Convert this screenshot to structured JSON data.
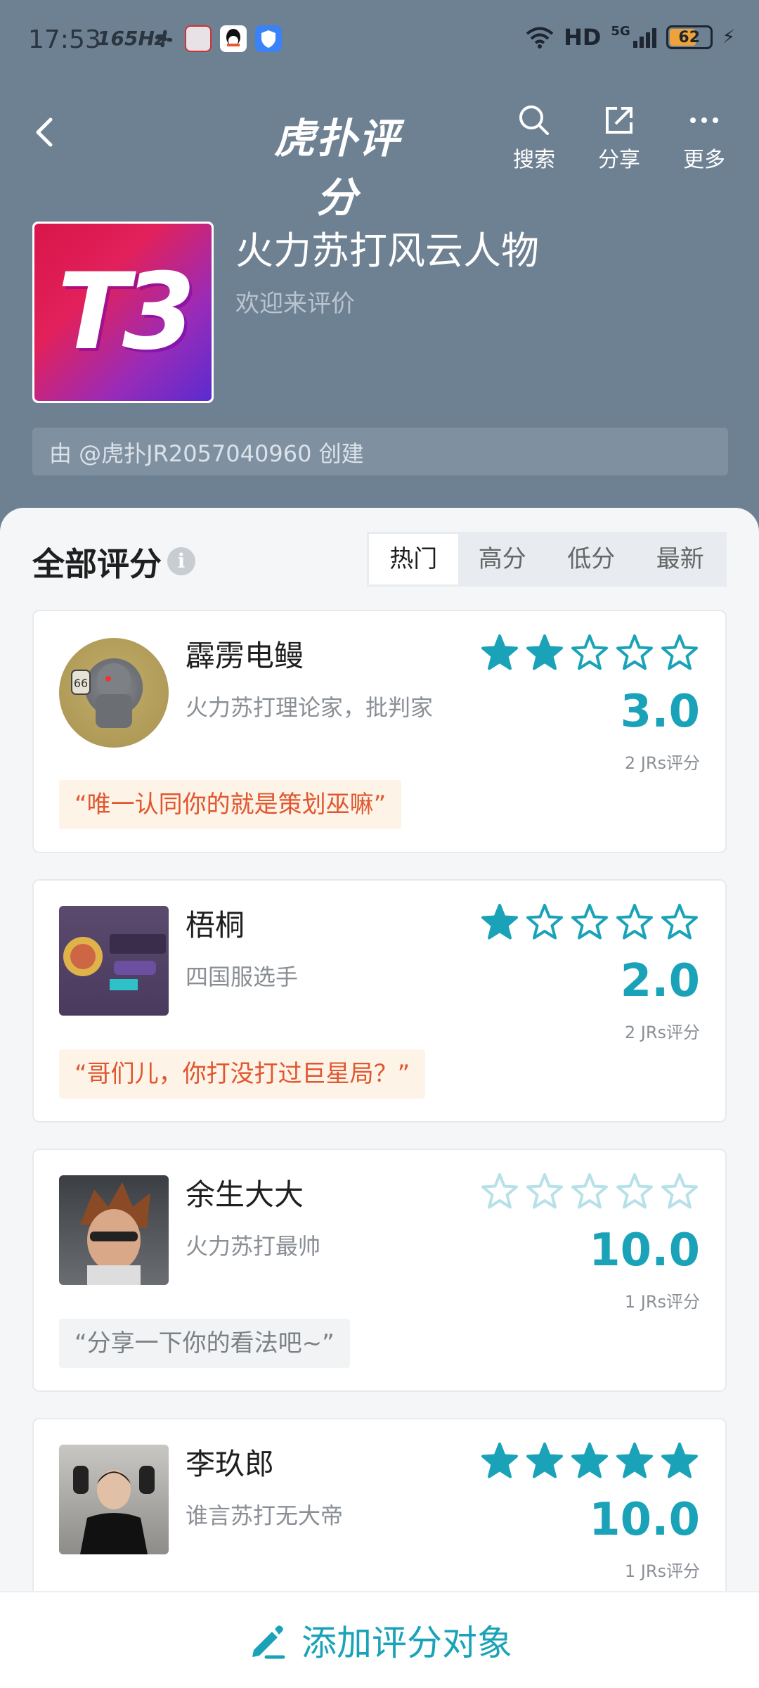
{
  "status_bar": {
    "time": "17:53",
    "refresh_rate": "165Hz",
    "network": "HD",
    "signal": "5G",
    "battery": "62"
  },
  "nav": {
    "logo_text": "虎扑评分",
    "search_label": "搜索",
    "share_label": "分享",
    "more_label": "更多"
  },
  "subject": {
    "icon_text": "T3",
    "title": "火力苏打风云人物",
    "subtitle": "欢迎来评价",
    "creator": "由 @虎扑JR2057040960 创建"
  },
  "section": {
    "title": "全部评分",
    "info_icon": "i"
  },
  "sort_tabs": [
    {
      "label": "热门",
      "active": true
    },
    {
      "label": "高分",
      "active": false
    },
    {
      "label": "低分",
      "active": false
    },
    {
      "label": "最新",
      "active": false
    }
  ],
  "items": [
    {
      "name": "霹雳电鳗",
      "desc": "火力苏打理论家，批判家",
      "stars_filled": 2,
      "stars_total": 5,
      "stars_style": "filled",
      "score": "3.0",
      "raters": "2 JRs评分",
      "quote": "“唯一认同你的就是策划巫嘛”",
      "quote_style": "hot",
      "avatar_style": "round"
    },
    {
      "name": "梧桐",
      "desc": "四国服选手",
      "stars_filled": 1,
      "stars_total": 5,
      "stars_style": "filled",
      "score": "2.0",
      "raters": "2 JRs评分",
      "quote": "“哥们儿，你打没打过巨星局？”",
      "quote_style": "hot",
      "avatar_style": "square"
    },
    {
      "name": "余生大大",
      "desc": "火力苏打最帅",
      "stars_filled": 0,
      "stars_total": 5,
      "stars_style": "faded",
      "score": "10.0",
      "raters": "1 JRs评分",
      "quote": "“分享一下你的看法吧~”",
      "quote_style": "empty",
      "avatar_style": "square"
    },
    {
      "name": "李玖郎",
      "desc": "谁言苏打无大帝",
      "stars_filled": 5,
      "stars_total": 5,
      "stars_style": "filled",
      "score": "10.0",
      "raters": "1 JRs评分",
      "quote": "",
      "quote_style": "none",
      "avatar_style": "square"
    }
  ],
  "bottom": {
    "add_label": "添加评分对象"
  },
  "colors": {
    "header_bg": "#6e8193",
    "accent": "#1aa3b8",
    "quote_text": "#e0562e",
    "quote_bg": "#fdf3e6"
  }
}
